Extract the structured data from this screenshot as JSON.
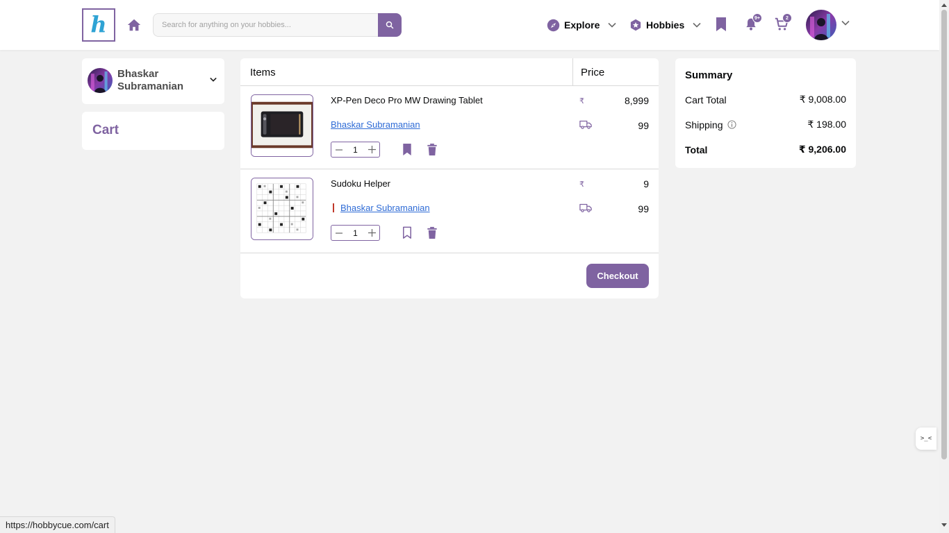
{
  "header": {
    "logo_letter": "h",
    "search_placeholder": "Search for anything on your hobbies...",
    "explore_label": "Explore",
    "hobbies_label": "Hobbies",
    "notifications_badge": "9+",
    "cart_badge": "2"
  },
  "sidebar": {
    "profile_name": "Bhaskar Subramanian",
    "cart_title": "Cart"
  },
  "cart": {
    "items_header": "Items",
    "price_header": "Price",
    "items": [
      {
        "title": "XP-Pen Deco Pro MW Drawing Tablet",
        "seller": "Bhaskar Subramanian",
        "quantity": "1",
        "price_symbol": "₹",
        "price": "8,999",
        "shipping": "99",
        "bookmarked": true
      },
      {
        "title": "Sudoku Helper",
        "seller": "Bhaskar Subramanian",
        "quantity": "1",
        "price_symbol": "₹",
        "price": "9",
        "shipping": "99",
        "bookmarked": false
      }
    ],
    "checkout_label": "Checkout"
  },
  "summary": {
    "title": "Summary",
    "cart_total_label": "Cart Total",
    "cart_total_value": "₹ 9,008.00",
    "shipping_label": "Shipping",
    "shipping_value": "₹ 198.00",
    "total_label": "Total",
    "total_value": "₹ 9,206.00"
  },
  "status_bar": {
    "url": "https://hobbycue.com/cart"
  },
  "widget": {
    "label": ">_<"
  },
  "colors": {
    "accent": "#7f63a1",
    "link": "#2e6bd6",
    "background": "#f2f2f2"
  }
}
